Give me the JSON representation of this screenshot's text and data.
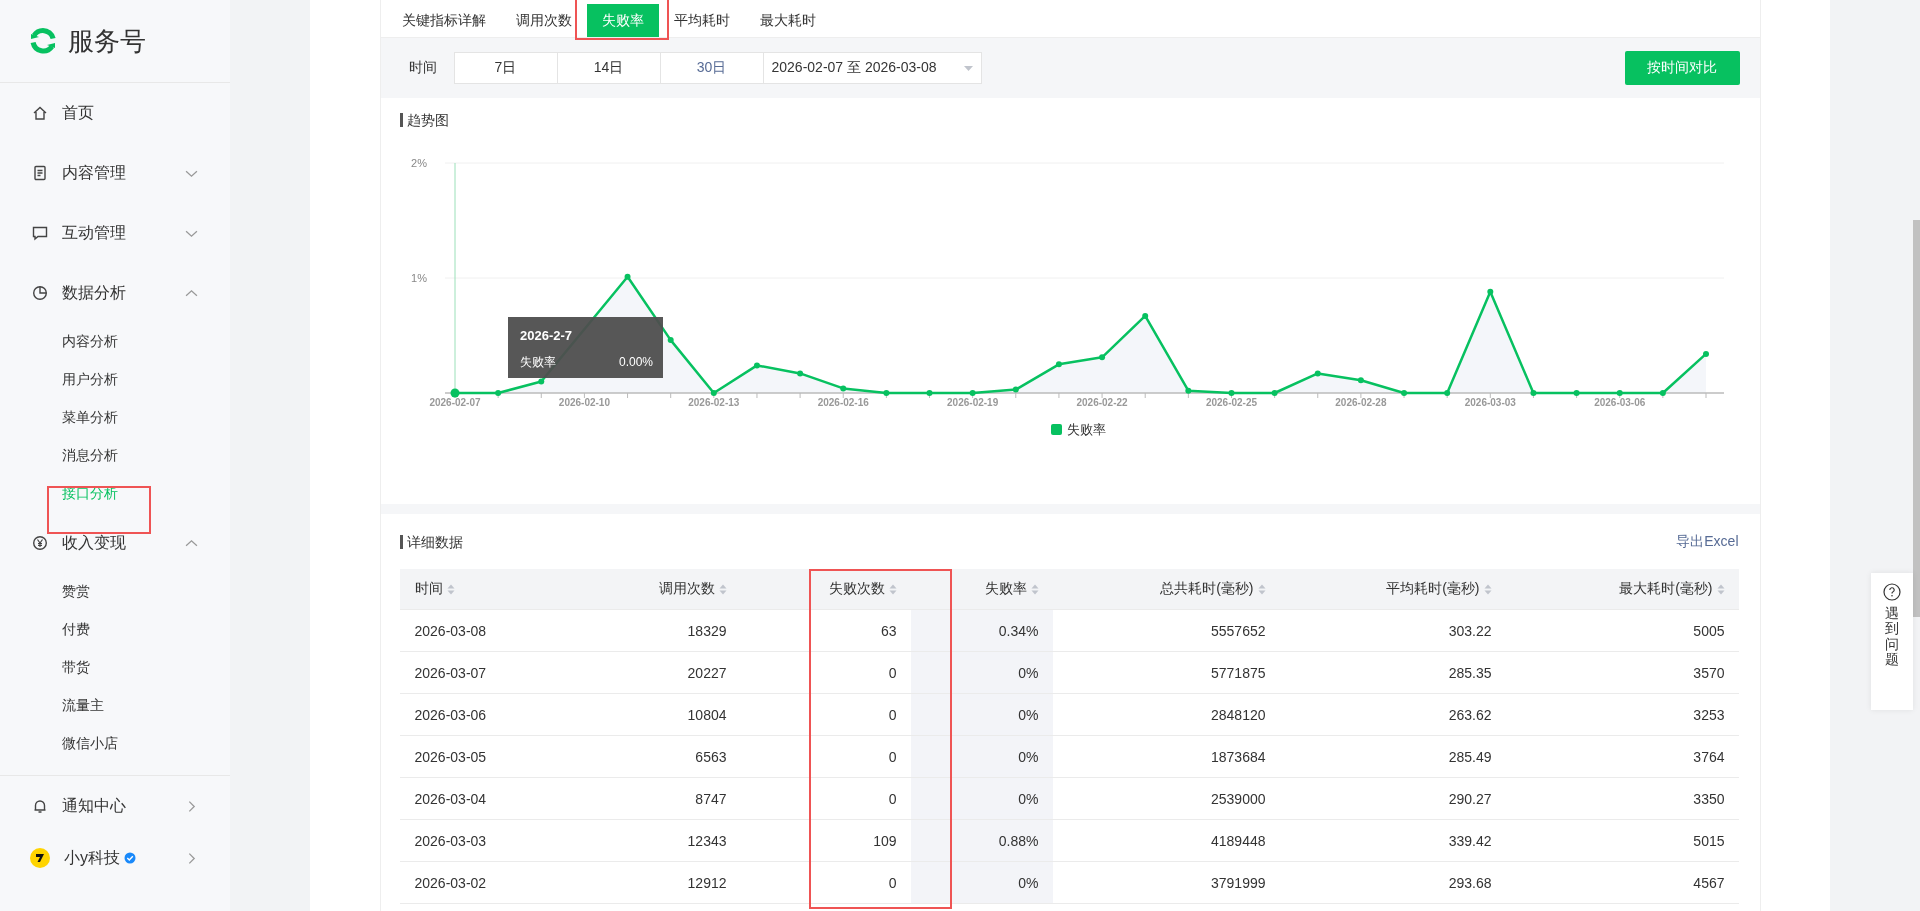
{
  "sidebar": {
    "title": "服务号",
    "items": [
      {
        "kind": "home",
        "label": "首页",
        "selected": false
      },
      {
        "kind": "document",
        "label": "内容管理",
        "selected": false,
        "expanded": false
      },
      {
        "kind": "chat",
        "label": "互动管理",
        "selected": false,
        "expanded": false
      },
      {
        "kind": "pie",
        "label": "数据分析",
        "selected": false,
        "expanded": true,
        "children": [
          {
            "label": "内容分析",
            "selected": false
          },
          {
            "label": "用户分析",
            "selected": false
          },
          {
            "label": "菜单分析",
            "selected": false
          },
          {
            "label": "消息分析",
            "selected": false
          },
          {
            "label": "接口分析",
            "selected": true
          }
        ]
      },
      {
        "kind": "yen",
        "label": "收入变现",
        "selected": false,
        "expanded": true,
        "children": [
          {
            "label": "赞赏",
            "selected": false
          },
          {
            "label": "付费",
            "selected": false
          },
          {
            "label": "带货",
            "selected": false
          },
          {
            "label": "流量主",
            "selected": false
          },
          {
            "label": "微信小店",
            "selected": false
          }
        ]
      }
    ],
    "bottom_items": [
      {
        "kind": "bell",
        "label": "通知中心"
      },
      {
        "kind": "account",
        "label": "小y科技",
        "verified": true
      }
    ]
  },
  "tabs": [
    {
      "label": "关键指标详解",
      "selected": false
    },
    {
      "label": "调用次数",
      "selected": false
    },
    {
      "label": "失败率",
      "selected": true
    },
    {
      "label": "平均耗时",
      "selected": false
    },
    {
      "label": "最大耗时",
      "selected": false
    }
  ],
  "filter": {
    "label": "时间",
    "ranges": [
      {
        "label": "7日",
        "selected": false
      },
      {
        "label": "14日",
        "selected": false
      },
      {
        "label": "30日",
        "selected": true
      }
    ],
    "date_range": "2026-02-07 至 2026-03-08",
    "compare_button": "按时间对比"
  },
  "trend": {
    "title": "趋势图",
    "tooltip": {
      "title": "2026-2-7",
      "label": "失败率",
      "value": "0.00%"
    },
    "chart_data": {
      "type": "line",
      "categories": [
        "2026-02-07",
        null,
        null,
        "2026-02-10",
        null,
        null,
        "2026-02-13",
        null,
        null,
        "2026-02-16",
        null,
        null,
        "2026-02-19",
        null,
        null,
        "2026-02-22",
        null,
        null,
        "2026-02-25",
        null,
        null,
        "2026-02-28",
        null,
        null,
        "2026-03-03",
        null,
        null,
        "2026-03-06",
        null,
        null
      ],
      "series": [
        {
          "name": "失败率",
          "color": "#07c160",
          "marker": true,
          "values": [
            0,
            0,
            0.1,
            null,
            1.01,
            0.46,
            0,
            0.24,
            0.17,
            0.04,
            0,
            0,
            0,
            0.03,
            0.25,
            0.31,
            0.67,
            0.02,
            0,
            0,
            0.17,
            0.11,
            0,
            0,
            0.88,
            0,
            0,
            0,
            0,
            0.34
          ]
        }
      ],
      "ylim": [
        0,
        2
      ],
      "yticks": [
        {
          "value": 1,
          "label": "1%"
        },
        {
          "value": 2,
          "label": "2%"
        }
      ]
    }
  },
  "details": {
    "title": "详细数据",
    "export_link": "导出Excel",
    "columns": [
      {
        "label": "时间",
        "highlighted": false
      },
      {
        "label": "调用次数",
        "highlighted": false
      },
      {
        "label": "失败次数",
        "highlighted": false
      },
      {
        "label": "失败率",
        "highlighted": true
      },
      {
        "label": "总共耗时(毫秒)",
        "highlighted": false
      },
      {
        "label": "平均耗时(毫秒)",
        "highlighted": false
      },
      {
        "label": "最大耗时(毫秒)",
        "highlighted": false
      }
    ],
    "rows": [
      [
        "2026-03-08",
        "18329",
        "63",
        "0.34%",
        "5557652",
        "303.22",
        "5005"
      ],
      [
        "2026-03-07",
        "20227",
        "0",
        "0%",
        "5771875",
        "285.35",
        "3570"
      ],
      [
        "2026-03-06",
        "10804",
        "0",
        "0%",
        "2848120",
        "263.62",
        "3253"
      ],
      [
        "2026-03-05",
        "6563",
        "0",
        "0%",
        "1873684",
        "285.49",
        "3764"
      ],
      [
        "2026-03-04",
        "8747",
        "0",
        "0%",
        "2539000",
        "290.27",
        "3350"
      ],
      [
        "2026-03-03",
        "12343",
        "109",
        "0.88%",
        "4189448",
        "339.42",
        "5015"
      ],
      [
        "2026-03-02",
        "12912",
        "0",
        "0%",
        "3791999",
        "293.68",
        "4567"
      ]
    ]
  },
  "help": {
    "label": "遇到问题"
  }
}
